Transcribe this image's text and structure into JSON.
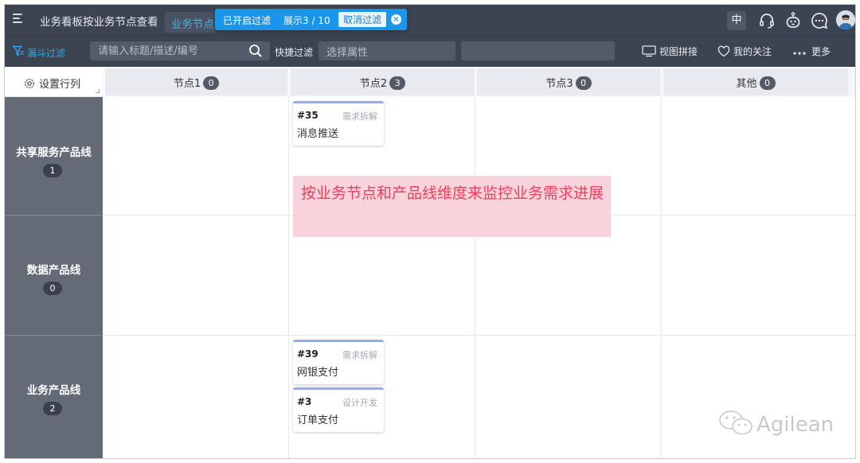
{
  "topbar": {
    "board_title": "业务看板按业务节点查看",
    "view_tab": "业务节点",
    "filter_status": "已开启过滤",
    "filter_count": "展示3 / 10",
    "cancel_filter": "取消过滤",
    "lang": "中"
  },
  "filterbar": {
    "funnel_label": "漏斗过滤",
    "search_placeholder": "请输入标题/描述/编号",
    "quick_filter_label": "快捷过滤",
    "attr_placeholder": "选择属性",
    "view_merge": "视图拼接",
    "my_follow": "我的关注",
    "more": "更多"
  },
  "board": {
    "settings_label": "设置行列",
    "columns": [
      {
        "name": "节点1",
        "count": "0"
      },
      {
        "name": "节点2",
        "count": "3"
      },
      {
        "name": "节点3",
        "count": "0"
      },
      {
        "name": "其他",
        "count": "0"
      }
    ],
    "lanes": [
      {
        "name": "共享服务产品线",
        "count": "1"
      },
      {
        "name": "数据产品线",
        "count": "0"
      },
      {
        "name": "业务产品线",
        "count": "2"
      }
    ],
    "cards": [
      {
        "id": "#35",
        "stage": "需求拆解",
        "title": "消息推送"
      },
      {
        "id": "#39",
        "stage": "需求拆解",
        "title": "网银支付"
      },
      {
        "id": "#3",
        "stage": "设计开发",
        "title": "订单支付"
      }
    ]
  },
  "annotation": "按业务节点和产品线维度来监控业务需求进展",
  "watermark": "Agilean",
  "colors": {
    "topbar_bg": "#3d4451",
    "accent_blue": "#1996ea",
    "lane_header_bg": "#646b77",
    "annotation_bg": "#f8cdd6",
    "annotation_text": "#e8425e"
  }
}
